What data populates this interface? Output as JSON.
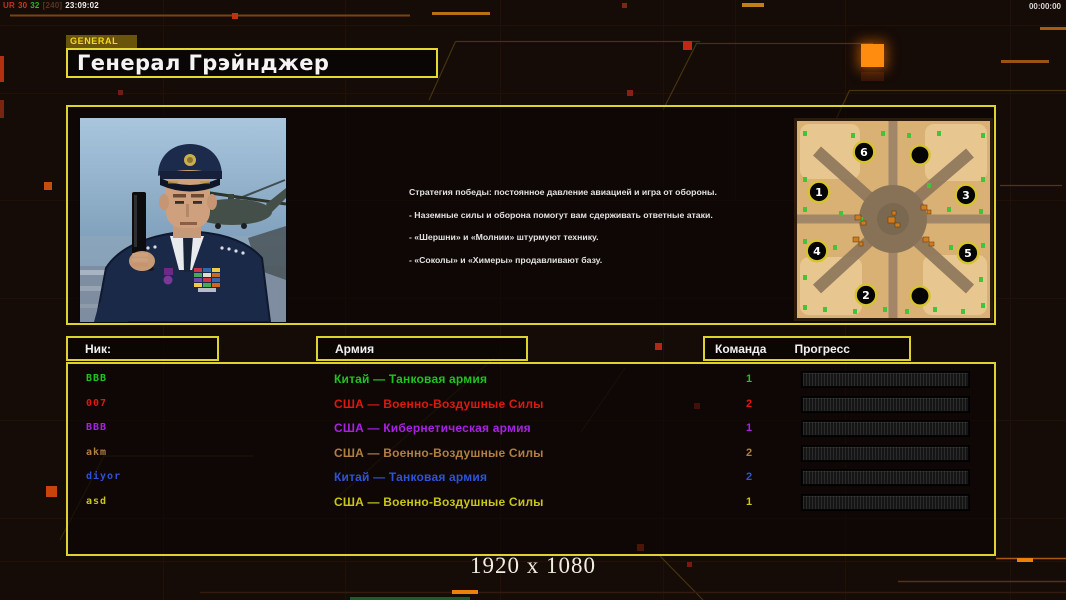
{
  "hud": {
    "debug": {
      "tag": "UR",
      "a": "30",
      "b": "32",
      "c": "[240]",
      "time": "23:09:02"
    },
    "clock": "00:00:00",
    "resolution_label": "1920 x 1080"
  },
  "tab_label": "GENERAL",
  "general_name": "Генерал Грэйнджер",
  "strategy_lines": [
    "Стратегия победы: постоянное давление авиацией и игра от обороны.",
    "- Наземные силы и оборона помогут вам сдерживать ответные атаки.",
    "- «Шершни» и «Молнии» штурмуют технику.",
    "- «Соколы» и «Химеры» продавливают базу."
  ],
  "columns": {
    "nick": "Ник:",
    "army": "Армия",
    "team": "Команда",
    "progress": "Прогресс"
  },
  "players": [
    {
      "nick": "BBB",
      "army": "Китай — Танковая армия",
      "team": "1",
      "color": "#1fc41f"
    },
    {
      "nick": "007",
      "army": "США — Военно-Воздушные Силы",
      "team": "2",
      "color": "#dc1810"
    },
    {
      "nick": "BBB",
      "army": "США — Кибернетическая армия",
      "team": "1",
      "color": "#a822e6"
    },
    {
      "nick": "akm",
      "army": "США — Военно-Воздушные Силы",
      "team": "2",
      "color": "#b07f42"
    },
    {
      "nick": "diyor",
      "army": "Китай — Танковая армия",
      "team": "2",
      "color": "#2f52d8"
    },
    {
      "nick": "asd",
      "army": "США — Военно-Воздушные Силы",
      "team": "1",
      "color": "#c9c614"
    }
  ],
  "minimap": {
    "spawns": [
      "6",
      "1",
      "3",
      "4",
      "5",
      "2"
    ]
  },
  "colors": {
    "accent_border": "#ddd22e",
    "led_orange": "#ff8c0e",
    "map_ring": "#d6c32e"
  }
}
